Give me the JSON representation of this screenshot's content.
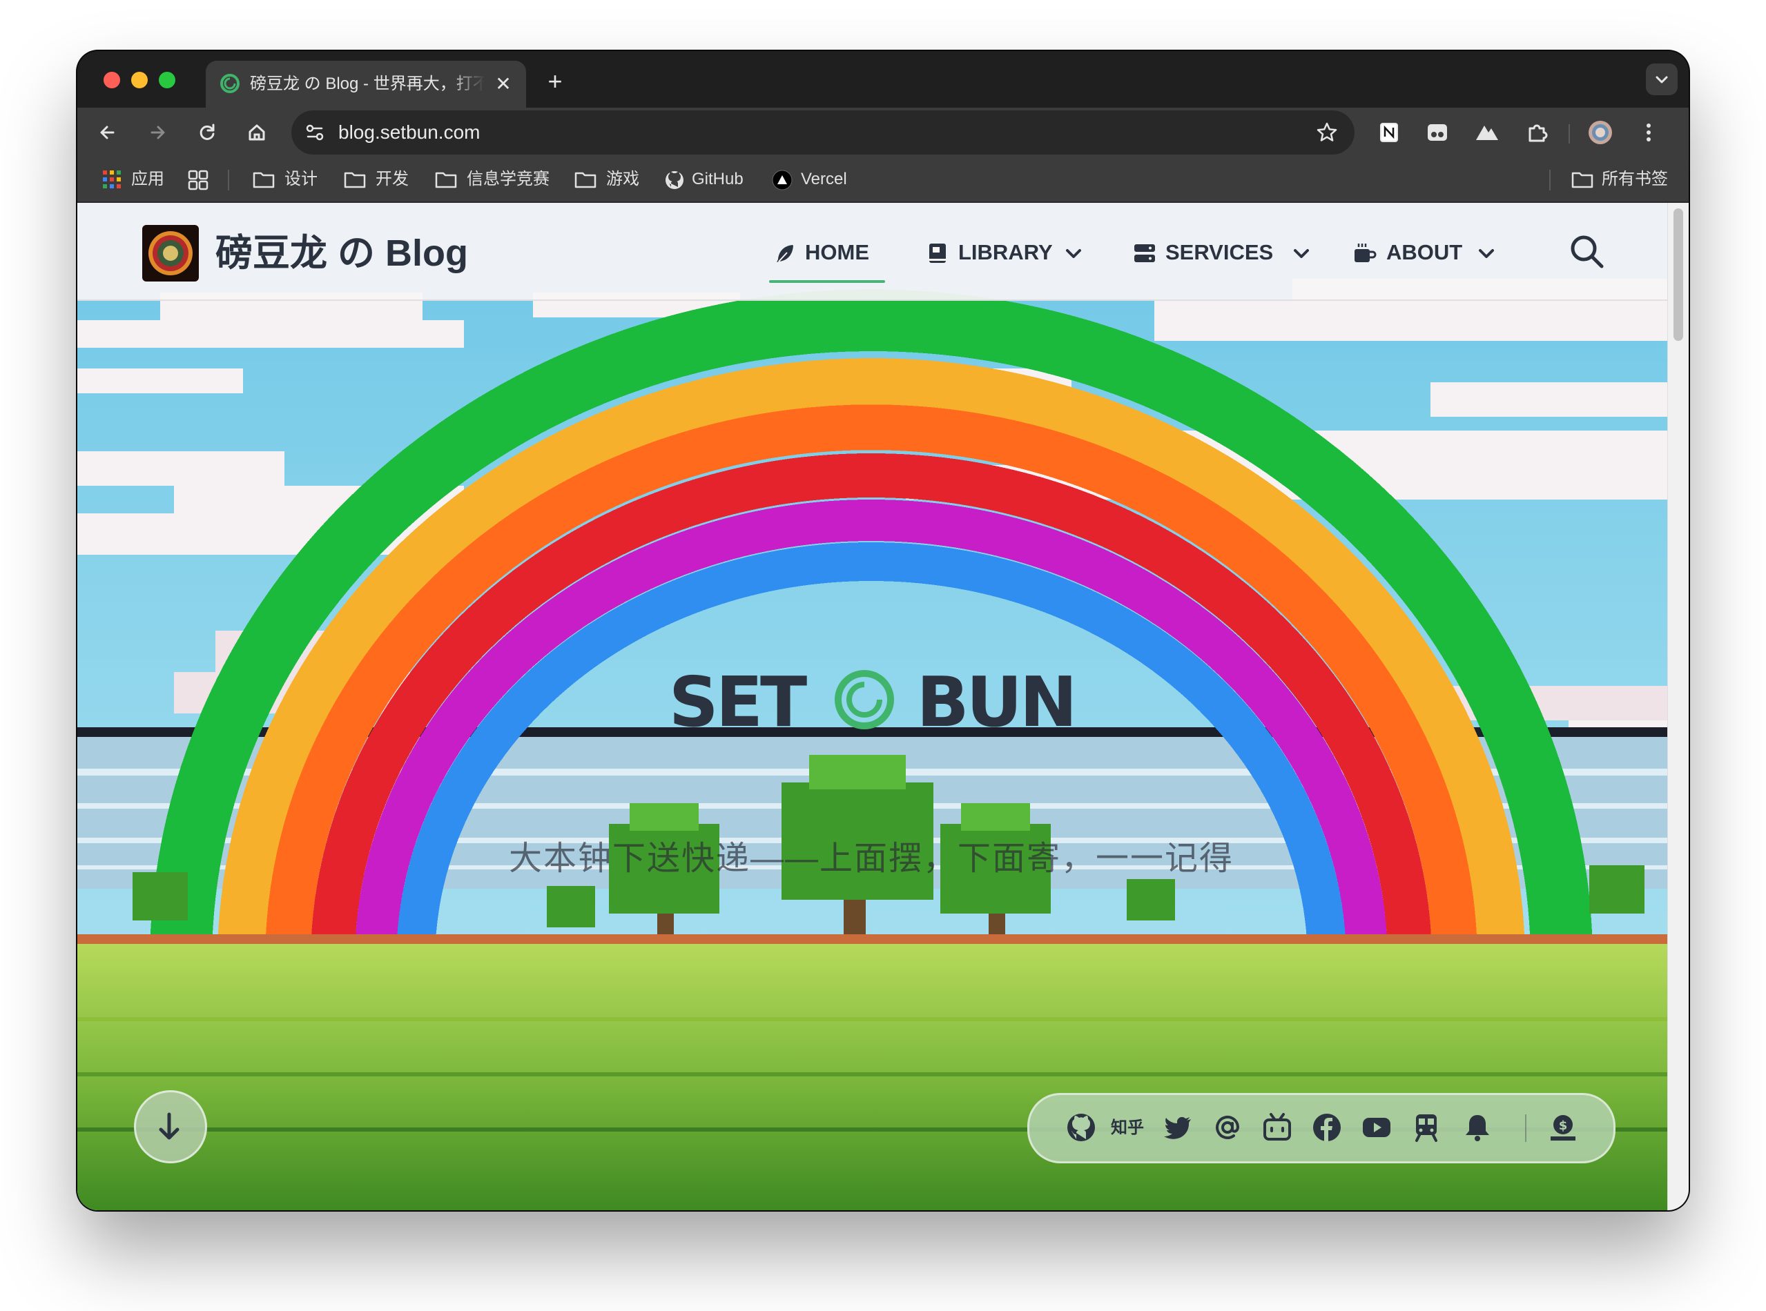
{
  "browser": {
    "tab": {
      "title": "磅豆龙 の Blog - 世界再大，打不过人心",
      "close": "✕"
    },
    "new_tab": "+",
    "url": "blog.setbun.com",
    "bookmarks": [
      {
        "label": "应用",
        "icon": "apps-grid-icon"
      },
      {
        "label": "",
        "icon": "tab-groups-icon"
      },
      {
        "label": "设计",
        "icon": "folder-icon"
      },
      {
        "label": "开发",
        "icon": "folder-icon"
      },
      {
        "label": "信息学竞赛",
        "icon": "folder-icon"
      },
      {
        "label": "游戏",
        "icon": "folder-icon"
      },
      {
        "label": "GitHub",
        "icon": "github-icon"
      },
      {
        "label": "Vercel",
        "icon": "vercel-icon"
      }
    ],
    "all_bookmarks": "所有书签"
  },
  "site": {
    "title": "磅豆龙 の Blog",
    "nav": [
      {
        "label": "HOME",
        "icon": "feather-icon",
        "active": true
      },
      {
        "label": "LIBRARY",
        "icon": "book-icon",
        "dropdown": true
      },
      {
        "label": "SERVICES",
        "icon": "server-icon",
        "dropdown": true
      },
      {
        "label": "ABOUT",
        "icon": "coffee-icon",
        "dropdown": true
      }
    ],
    "hero": {
      "brand": "SET◎BUN",
      "brand_left": "SET",
      "brand_right": "BUN",
      "tagline": "大本钟下送快递——上面摆，下面寄，一一记得"
    },
    "social": {
      "zhihu": "知乎",
      "icons": [
        "github-icon",
        "zhihu-icon",
        "twitter-icon",
        "at-icon",
        "bilibili-icon",
        "facebook-icon",
        "youtube-icon",
        "train-icon",
        "bell-icon",
        "donate-icon"
      ]
    }
  },
  "colors": {
    "accent": "#49b37a",
    "chrome_dark": "#1f1f1f",
    "chrome": "#3c3c3c",
    "text": "#2b3240"
  }
}
